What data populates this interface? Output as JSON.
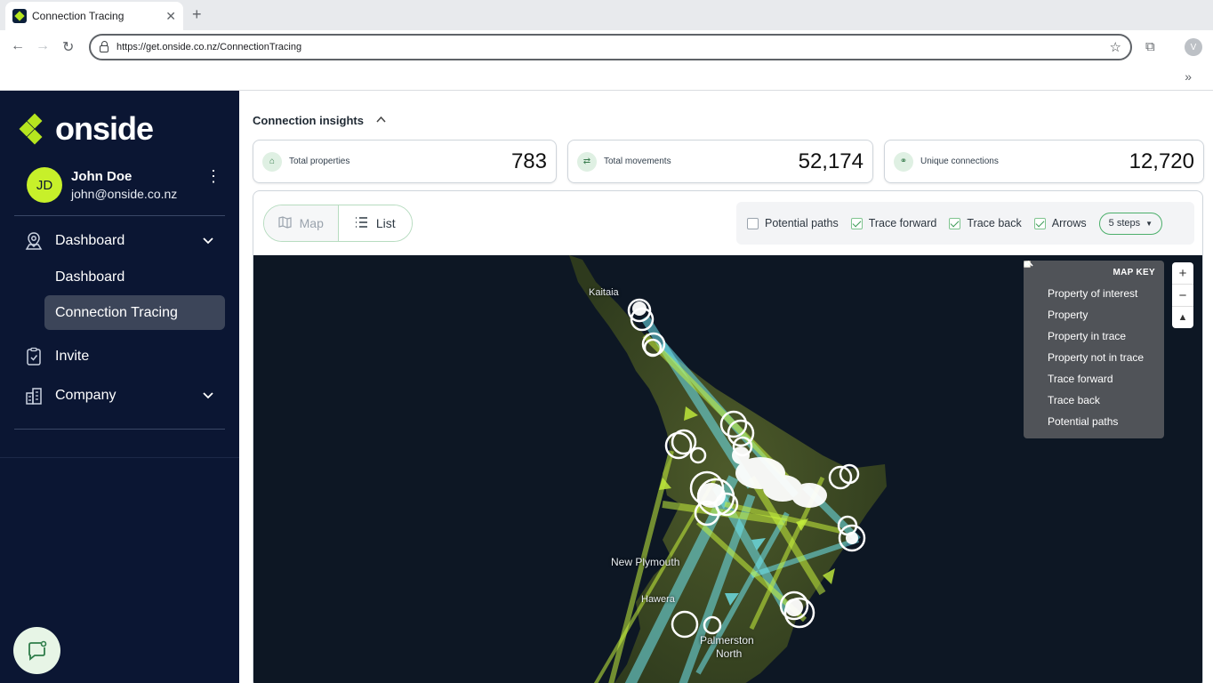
{
  "browser": {
    "tab_title": "Connection Tracing",
    "tab_close": "✕",
    "new_tab": "+",
    "url": "https://get.onside.co.nz/ConnectionTracing",
    "profile_initial": "V",
    "more": "»"
  },
  "sidebar": {
    "logo": "onside",
    "user": {
      "initials": "JD",
      "name": "John Doe",
      "email": "john@onside.co.nz"
    },
    "nav": [
      {
        "label": "Dashboard",
        "icon": "map-pin-icon",
        "expandable": true
      },
      {
        "label": "Invite",
        "icon": "clipboard-icon",
        "expandable": false
      },
      {
        "label": "Company",
        "icon": "building-icon",
        "expandable": true
      }
    ],
    "sub_nav": [
      {
        "label": "Dashboard",
        "active": false
      },
      {
        "label": "Connection Tracing",
        "active": true
      }
    ]
  },
  "insights": {
    "title": "Connection insights",
    "cards": [
      {
        "label": "Total properties",
        "value": "783",
        "icon": "house-icon"
      },
      {
        "label": "Total movements",
        "value": "52,174",
        "icon": "swap-icon"
      },
      {
        "label": "Unique connections",
        "value": "12,720",
        "icon": "connections-icon"
      }
    ]
  },
  "view_toggle": {
    "map": "Map",
    "list": "List",
    "selected": "List"
  },
  "filters": {
    "potential_paths": {
      "label": "Potential paths",
      "checked": false
    },
    "trace_forward": {
      "label": "Trace forward",
      "checked": true
    },
    "trace_back": {
      "label": "Trace back",
      "checked": true
    },
    "arrows": {
      "label": "Arrows",
      "checked": true
    },
    "steps": "5 steps"
  },
  "map": {
    "places": [
      "Kaitaia",
      "New Plymouth",
      "Hawera",
      "Palmerston",
      "North"
    ],
    "key_title": "MAP KEY",
    "key_items": [
      {
        "label": "Property of interest",
        "symbol": "filled-dot",
        "color": "#ffffff"
      },
      {
        "label": "Property",
        "symbol": "ring",
        "color": "#ffffff"
      },
      {
        "label": "Property in trace",
        "symbol": "square",
        "color": "#e3c85a"
      },
      {
        "label": "Property not in trace",
        "symbol": "square",
        "color": "#ffffff"
      },
      {
        "label": "Trace forward",
        "symbol": "triangle",
        "color": "#c6f03c"
      },
      {
        "label": "Trace back",
        "symbol": "triangle",
        "color": "#6fe3ee"
      },
      {
        "label": "Potential paths",
        "symbol": "triangle",
        "color": "#ffffff"
      }
    ],
    "zoom_in": "+",
    "zoom_out": "−",
    "compass": "▲"
  },
  "colors": {
    "sidebar_bg": "#0b1633",
    "accent": "#c7f02a",
    "trace_forward": "#c6f03c",
    "trace_back": "#6fe3ee"
  }
}
